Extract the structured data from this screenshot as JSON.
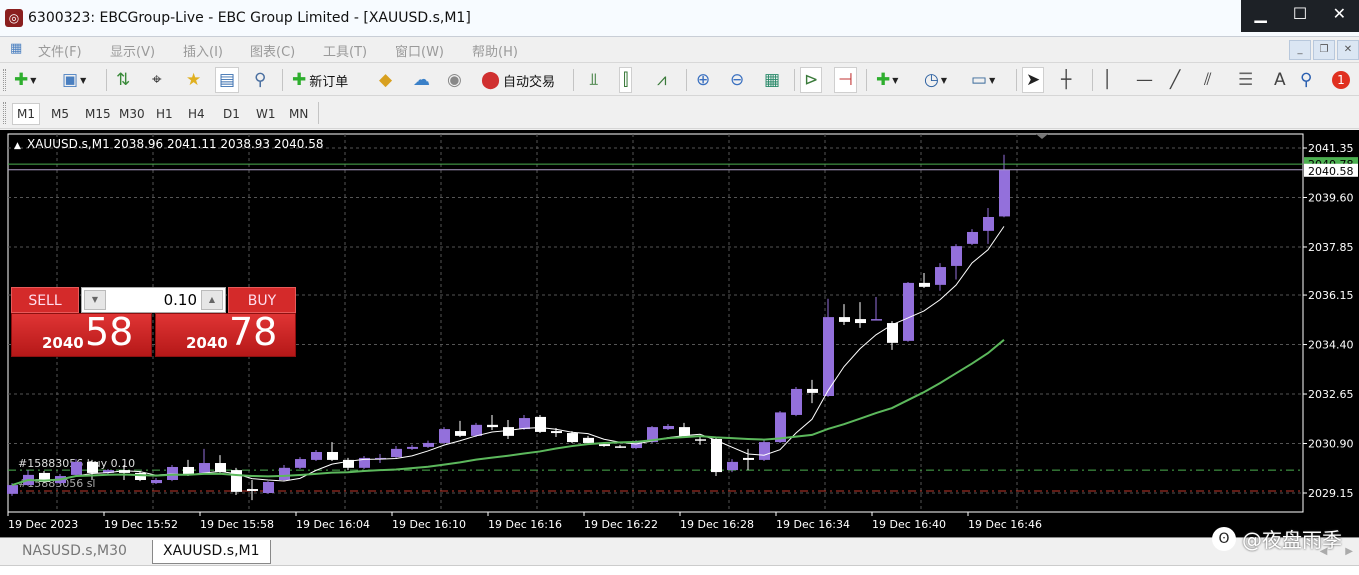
{
  "window": {
    "title": "6300323: EBCGroup-Live - EBC Group Limited - [XAUUSD.s,M1]",
    "controls": [
      "minimize",
      "maximize",
      "close"
    ]
  },
  "menu": [
    "文件(F)",
    "显示(V)",
    "插入(I)",
    "图表(C)",
    "工具(T)",
    "窗口(W)",
    "帮助(H)"
  ],
  "toolbar": {
    "items": [
      {
        "icon": "new-chart-icon",
        "glyph": "✚",
        "color": "#2eae2e",
        "dropdown": true
      },
      {
        "icon": "profiles-icon",
        "glyph": "▣",
        "color": "#4a7fc0",
        "dropdown": true
      },
      {
        "icon": "market-watch-icon",
        "glyph": "⇅",
        "color": "#3a8a3a"
      },
      {
        "icon": "data-window-icon",
        "glyph": "⌖",
        "color": "#333"
      },
      {
        "icon": "navigator-icon",
        "glyph": "★",
        "color": "#e0b020"
      },
      {
        "icon": "terminal-icon",
        "glyph": "▤",
        "color": "#3a6fb0",
        "pressed": true
      },
      {
        "icon": "strategy-tester-icon",
        "glyph": "⚲",
        "color": "#4a6fa0"
      },
      {
        "icon": "new-order-icon",
        "glyph": "✚",
        "color": "#2eae2e",
        "label": "新订单"
      },
      {
        "icon": "metaeditor-icon",
        "glyph": "◆",
        "color": "#d8a020"
      },
      {
        "icon": "market-icon",
        "glyph": "☁",
        "color": "#3a80c8"
      },
      {
        "icon": "signals-icon",
        "glyph": "◉",
        "color": "#888"
      },
      {
        "icon": "auto-trading-icon",
        "glyph": "⬤",
        "color": "#d03030",
        "label": "自动交易"
      },
      {
        "icon": "bar-chart-icon",
        "glyph": "⫫",
        "color": "#3a7a3a"
      },
      {
        "icon": "candlestick-icon",
        "glyph": "⫿",
        "color": "#3a7a3a",
        "pressed": true
      },
      {
        "icon": "line-chart-icon",
        "glyph": "⩘",
        "color": "#3a7a3a"
      },
      {
        "icon": "zoom-in-icon",
        "glyph": "⊕",
        "color": "#3a70c0"
      },
      {
        "icon": "zoom-out-icon",
        "glyph": "⊖",
        "color": "#3a70c0"
      },
      {
        "icon": "tile-windows-icon",
        "glyph": "▦",
        "color": "#2a8a6a"
      },
      {
        "icon": "auto-scroll-icon",
        "glyph": "⊳",
        "color": "#3a7a3a",
        "pressed": true
      },
      {
        "icon": "chart-shift-icon",
        "glyph": "⊣",
        "color": "#c03030",
        "pressed": true
      },
      {
        "icon": "indicators-icon",
        "glyph": "✚",
        "color": "#2eae2e",
        "dropdown": true
      },
      {
        "icon": "periods-icon",
        "glyph": "◷",
        "color": "#2a5fa0",
        "dropdown": true
      },
      {
        "icon": "templates-icon",
        "glyph": "▭",
        "color": "#3a6a9a",
        "dropdown": true
      },
      {
        "icon": "cursor-icon",
        "glyph": "➤",
        "color": "#222",
        "pressed": true
      },
      {
        "icon": "crosshair-icon",
        "glyph": "┼",
        "color": "#444"
      },
      {
        "icon": "vertical-line-icon",
        "glyph": "│",
        "color": "#444"
      },
      {
        "icon": "horizontal-line-icon",
        "glyph": "—",
        "color": "#444"
      },
      {
        "icon": "trendline-icon",
        "glyph": "╱",
        "color": "#444"
      },
      {
        "icon": "equidistant-channel-icon",
        "glyph": "⫽",
        "color": "#444"
      },
      {
        "icon": "fibonacci-icon",
        "glyph": "☰",
        "color": "#666"
      },
      {
        "icon": "text-icon",
        "glyph": "A",
        "color": "#444"
      },
      {
        "icon": "search-icon",
        "glyph": "⚲",
        "color": "#2a5fb0"
      },
      {
        "icon": "notification-icon",
        "glyph": "1",
        "color": "#fff",
        "badge": true
      }
    ]
  },
  "timeframes": {
    "items": [
      "M1",
      "M5",
      "M15",
      "M30",
      "H1",
      "H4",
      "D1",
      "W1",
      "MN"
    ],
    "active": "M1"
  },
  "chart_header": "XAUUSD.s,M1  2038.96 2041.11 2038.93 2040.58",
  "one_click": {
    "sell_label": "SELL",
    "buy_label": "BUY",
    "lot": "0.10",
    "sell_big": "58",
    "sell_small": "2040",
    "buy_big": "78",
    "buy_small": "2040"
  },
  "trade_label": "#15883056 buy 0.10",
  "sl_label": "#15883056 sl",
  "colors": {
    "bull": "#9370db",
    "bear": "#ffffff",
    "ma_fast": "#ffffff",
    "ma_slow": "#5cb85c",
    "ask_line": "#4caf50",
    "bid_line": "#b0a0c8",
    "order_line": "#4caf50",
    "sl_line": "#c0392b",
    "background": "#000000",
    "grid": "#555555"
  },
  "chart_data": {
    "type": "candlestick",
    "symbol": "XAUUSD.s",
    "timeframe": "M1",
    "ylim": [
      2028.75,
      2041.6
    ],
    "y_ticks": [
      "2041.35",
      "2039.60",
      "2037.85",
      "2036.15",
      "2034.40",
      "2032.65",
      "2030.90",
      "2029.15"
    ],
    "x_ticks": [
      "19 Dec 2023",
      "19 Dec 15:52",
      "19 Dec 15:58",
      "19 Dec 16:04",
      "19 Dec 16:10",
      "19 Dec 16:16",
      "19 Dec 16:22",
      "19 Dec 16:28",
      "19 Dec 16:34",
      "19 Dec 16:40",
      "19 Dec 16:46"
    ],
    "ask": "2040.78",
    "bid": "2040.58",
    "order_price": 2029.96,
    "sl_price": 2029.22,
    "grid": true,
    "ohlc": [
      [
        2029.12,
        2029.5,
        2029.05,
        2029.43
      ],
      [
        2029.43,
        2029.96,
        2029.4,
        2029.79
      ],
      [
        2029.86,
        2029.93,
        2029.5,
        2029.54
      ],
      [
        2029.5,
        2029.82,
        2029.47,
        2029.75
      ],
      [
        2029.79,
        2030.35,
        2029.75,
        2030.25
      ],
      [
        2030.25,
        2030.32,
        2029.61,
        2029.86
      ],
      [
        2029.86,
        2030.0,
        2029.82,
        2029.96
      ],
      [
        2029.96,
        2030.14,
        2029.61,
        2029.86
      ],
      [
        2029.86,
        2029.93,
        2029.57,
        2029.61
      ],
      [
        2029.5,
        2029.68,
        2029.47,
        2029.61
      ],
      [
        2029.61,
        2030.14,
        2029.57,
        2030.07
      ],
      [
        2030.07,
        2030.32,
        2029.75,
        2029.79
      ],
      [
        2029.86,
        2030.71,
        2029.82,
        2030.21
      ],
      [
        2030.21,
        2030.49,
        2029.86,
        2029.89
      ],
      [
        2029.96,
        2030.04,
        2029.08,
        2029.19
      ],
      [
        2029.29,
        2029.61,
        2028.9,
        2029.22
      ],
      [
        2029.15,
        2029.57,
        2029.12,
        2029.54
      ],
      [
        2029.61,
        2030.14,
        2029.57,
        2030.04
      ],
      [
        2030.04,
        2030.42,
        2030.0,
        2030.35
      ],
      [
        2030.32,
        2030.67,
        2030.28,
        2030.6
      ],
      [
        2030.6,
        2030.95,
        2030.28,
        2030.32
      ],
      [
        2030.32,
        2030.39,
        2029.96,
        2030.04
      ],
      [
        2030.04,
        2030.46,
        2030.0,
        2030.39
      ],
      [
        2030.39,
        2030.53,
        2030.21,
        2030.39
      ],
      [
        2030.42,
        2030.81,
        2030.39,
        2030.71
      ],
      [
        2030.71,
        2030.85,
        2030.67,
        2030.78
      ],
      [
        2030.78,
        2031.0,
        2030.74,
        2030.92
      ],
      [
        2030.92,
        2031.48,
        2030.88,
        2031.41
      ],
      [
        2031.34,
        2031.7,
        2031.13,
        2031.17
      ],
      [
        2031.17,
        2031.63,
        2031.13,
        2031.56
      ],
      [
        2031.56,
        2031.91,
        2031.38,
        2031.48
      ],
      [
        2031.48,
        2031.73,
        2031.06,
        2031.17
      ],
      [
        2031.41,
        2031.91,
        2031.38,
        2031.8
      ],
      [
        2031.84,
        2031.91,
        2031.27,
        2031.31
      ],
      [
        2031.34,
        2031.45,
        2031.13,
        2031.27
      ],
      [
        2031.27,
        2031.34,
        2030.92,
        2030.95
      ],
      [
        2031.1,
        2031.17,
        2030.85,
        2030.92
      ],
      [
        2030.88,
        2030.95,
        2030.78,
        2030.81
      ],
      [
        2030.8,
        2030.85,
        2030.74,
        2030.78
      ],
      [
        2030.74,
        2031.02,
        2030.7,
        2030.95
      ],
      [
        2030.95,
        2031.52,
        2030.92,
        2031.48
      ],
      [
        2031.41,
        2031.59,
        2031.38,
        2031.52
      ],
      [
        2031.48,
        2031.63,
        2031.1,
        2031.17
      ],
      [
        2031.05,
        2031.17,
        2030.85,
        2031.02
      ],
      [
        2031.06,
        2031.13,
        2029.75,
        2029.89
      ],
      [
        2029.96,
        2030.35,
        2029.89,
        2030.25
      ],
      [
        2030.39,
        2030.71,
        2029.96,
        2030.32
      ],
      [
        2030.32,
        2031.02,
        2030.28,
        2030.95
      ],
      [
        2030.95,
        2032.05,
        2030.92,
        2032.0
      ],
      [
        2031.91,
        2032.9,
        2031.87,
        2032.83
      ],
      [
        2032.83,
        2033.15,
        2032.33,
        2032.69
      ],
      [
        2032.58,
        2036.02,
        2032.55,
        2035.37
      ],
      [
        2035.37,
        2035.83,
        2035.09,
        2035.2
      ],
      [
        2035.3,
        2035.9,
        2034.99,
        2035.16
      ],
      [
        2035.27,
        2036.08,
        2035.27,
        2035.3
      ],
      [
        2035.16,
        2035.23,
        2034.21,
        2034.46
      ],
      [
        2034.53,
        2036.61,
        2034.5,
        2036.58
      ],
      [
        2036.58,
        2036.93,
        2036.4,
        2036.44
      ],
      [
        2036.51,
        2037.28,
        2036.3,
        2037.14
      ],
      [
        2037.18,
        2037.95,
        2036.7,
        2037.88
      ],
      [
        2037.96,
        2038.48,
        2037.92,
        2038.38
      ],
      [
        2038.42,
        2039.23,
        2037.96,
        2038.91
      ],
      [
        2038.93,
        2041.11,
        2038.9,
        2040.58
      ]
    ]
  },
  "tabs": [
    {
      "label": "NASUSD.s,M30",
      "active": false
    },
    {
      "label": "XAUUSD.s,M1",
      "active": true
    }
  ],
  "watermark": "@夜盘雨季"
}
